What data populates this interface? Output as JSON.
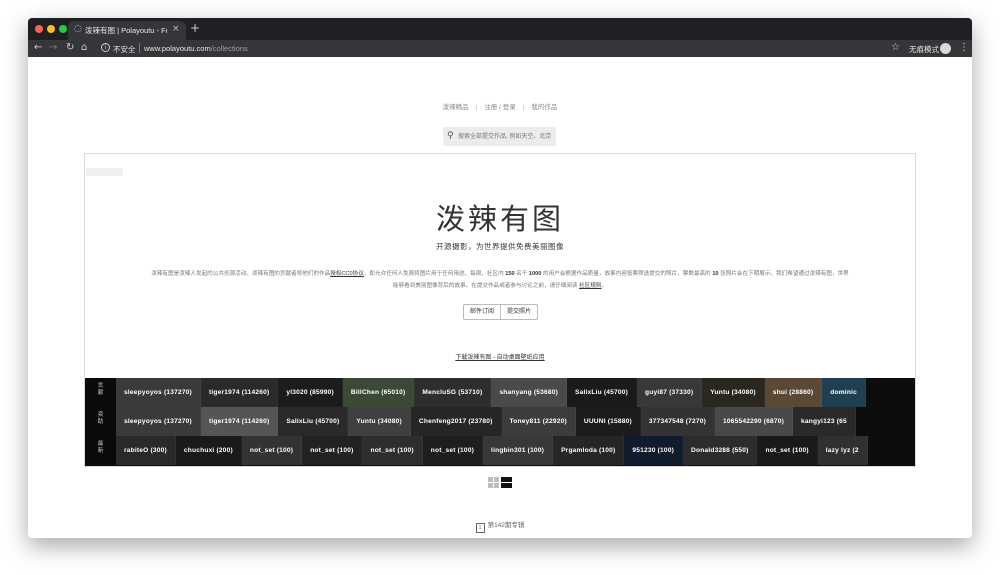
{
  "browser": {
    "tab_title": "泼辣有图 | Polayoutu - Free Ch",
    "tab_close": "×",
    "new_tab": "+",
    "back": "←",
    "forward": "→",
    "reload": "↻",
    "home": "⌂",
    "insecure_label": "不安全",
    "url_host": "www.polayoutu.com",
    "url_path": "/collections",
    "bookmark_star": "☆",
    "incognito_label": "无痕模式",
    "menu": "⋮"
  },
  "nav": {
    "items": [
      "泼辣精品",
      "注册 / 登录",
      "我的作品"
    ],
    "separator": "|"
  },
  "search": {
    "icon": "⚲",
    "placeholder": "搜索全部提交作品, 例如天空、北京"
  },
  "hero": {
    "title": "泼辣有图",
    "subtitle": "开源摄影，为世界提供免费美丽图像",
    "desc_part1": "泼辣有图是泼辣人发起的公共创源活动。泼辣有图的贡献者将他们的作品",
    "license_link": "授权CC0协议",
    "desc_part2": "，即允许任何人免费将图片用于任何用途。每周，社区内",
    "num_150": "150",
    "desc_part3": "名千",
    "num_1000": "1000",
    "desc_part4": "的用户会根据作品质量，故事内容投票筛选提交的照片，票数最高的",
    "num_10": "10",
    "desc_part5": "张照片会在下期展示。我们希望通过泼辣有图，世界能够看到美丽图像背后的故事。在提交作品或者参与讨论之前，请仔细阅读",
    "rules_link": "社区规则",
    "desc_end": "。",
    "btn_subscribe": "邮件订阅",
    "btn_submit": "提交照片",
    "download_link": "下载泼辣有图 - 自动桌面壁纸应用"
  },
  "strip": {
    "rows": [
      {
        "label": [
          "贡",
          "献"
        ],
        "chips": [
          {
            "text": "sleepyoyos (137270)",
            "bg": "#3a3a3a"
          },
          {
            "text": "tiger1974 (114260)",
            "bg": "#2a2a2a"
          },
          {
            "text": "yl3020 (85990)",
            "bg": "#1c1c1c"
          },
          {
            "text": "BillChen (65010)",
            "bg": "#3a4a35"
          },
          {
            "text": "MencluSG (53710)",
            "bg": "#2e2e2e"
          },
          {
            "text": "shanyang (53680)",
            "bg": "#4a4a4a"
          },
          {
            "text": "SalixLiu (45700)",
            "bg": "#1a1a1a"
          },
          {
            "text": "guyi87 (37330)",
            "bg": "#383838"
          },
          {
            "text": "Yuntu (34080)",
            "bg": "#2a2620"
          },
          {
            "text": "shui (28860)",
            "bg": "#5a4a35"
          },
          {
            "text": "dominic",
            "bg": "#1e4050"
          }
        ]
      },
      {
        "label": [
          "资",
          "助"
        ],
        "chips": [
          {
            "text": "sleepyoyos (137270)",
            "bg": "#3a3a3a"
          },
          {
            "text": "tiger1974 (114260)",
            "bg": "#555555"
          },
          {
            "text": "SalixLiu (45700)",
            "bg": "#2a2a2a"
          },
          {
            "text": "Yuntu (34080)",
            "bg": "#404040"
          },
          {
            "text": "Chenfeng2017 (23780)",
            "bg": "#262626"
          },
          {
            "text": "Toney811 (22920)",
            "bg": "#3c3c3c"
          },
          {
            "text": "UUUNI (15880)",
            "bg": "#1c1c1c"
          },
          {
            "text": "377347548 (7270)",
            "bg": "#333333"
          },
          {
            "text": "1065542290 (6870)",
            "bg": "#484848"
          },
          {
            "text": "kangyi123 (65",
            "bg": "#2a2a2a"
          }
        ]
      },
      {
        "label": [
          "最",
          "新"
        ],
        "chips": [
          {
            "text": "rabiteO (300)",
            "bg": "#2a2a2a"
          },
          {
            "text": "chuchuxi (200)",
            "bg": "#1a1a1a"
          },
          {
            "text": "not_set (100)",
            "bg": "#333333"
          },
          {
            "text": "not_set (100)",
            "bg": "#222222"
          },
          {
            "text": "not_set (100)",
            "bg": "#2e2e2e"
          },
          {
            "text": "not_set (100)",
            "bg": "#1e1e1e"
          },
          {
            "text": "lingbin301 (100)",
            "bg": "#383838"
          },
          {
            "text": "Prgamloda (100)",
            "bg": "#262626"
          },
          {
            "text": "951230 (100)",
            "bg": "#101c2c"
          },
          {
            "text": "Donald3288 (550)",
            "bg": "#2c2c2c"
          },
          {
            "text": "not_set (100)",
            "bg": "#1a1a1a"
          },
          {
            "text": "lazy lyz (2",
            "bg": "#303030"
          }
        ]
      }
    ]
  },
  "footer": {
    "calendar_glyph": "1",
    "issue_label": "第142期专辑"
  }
}
